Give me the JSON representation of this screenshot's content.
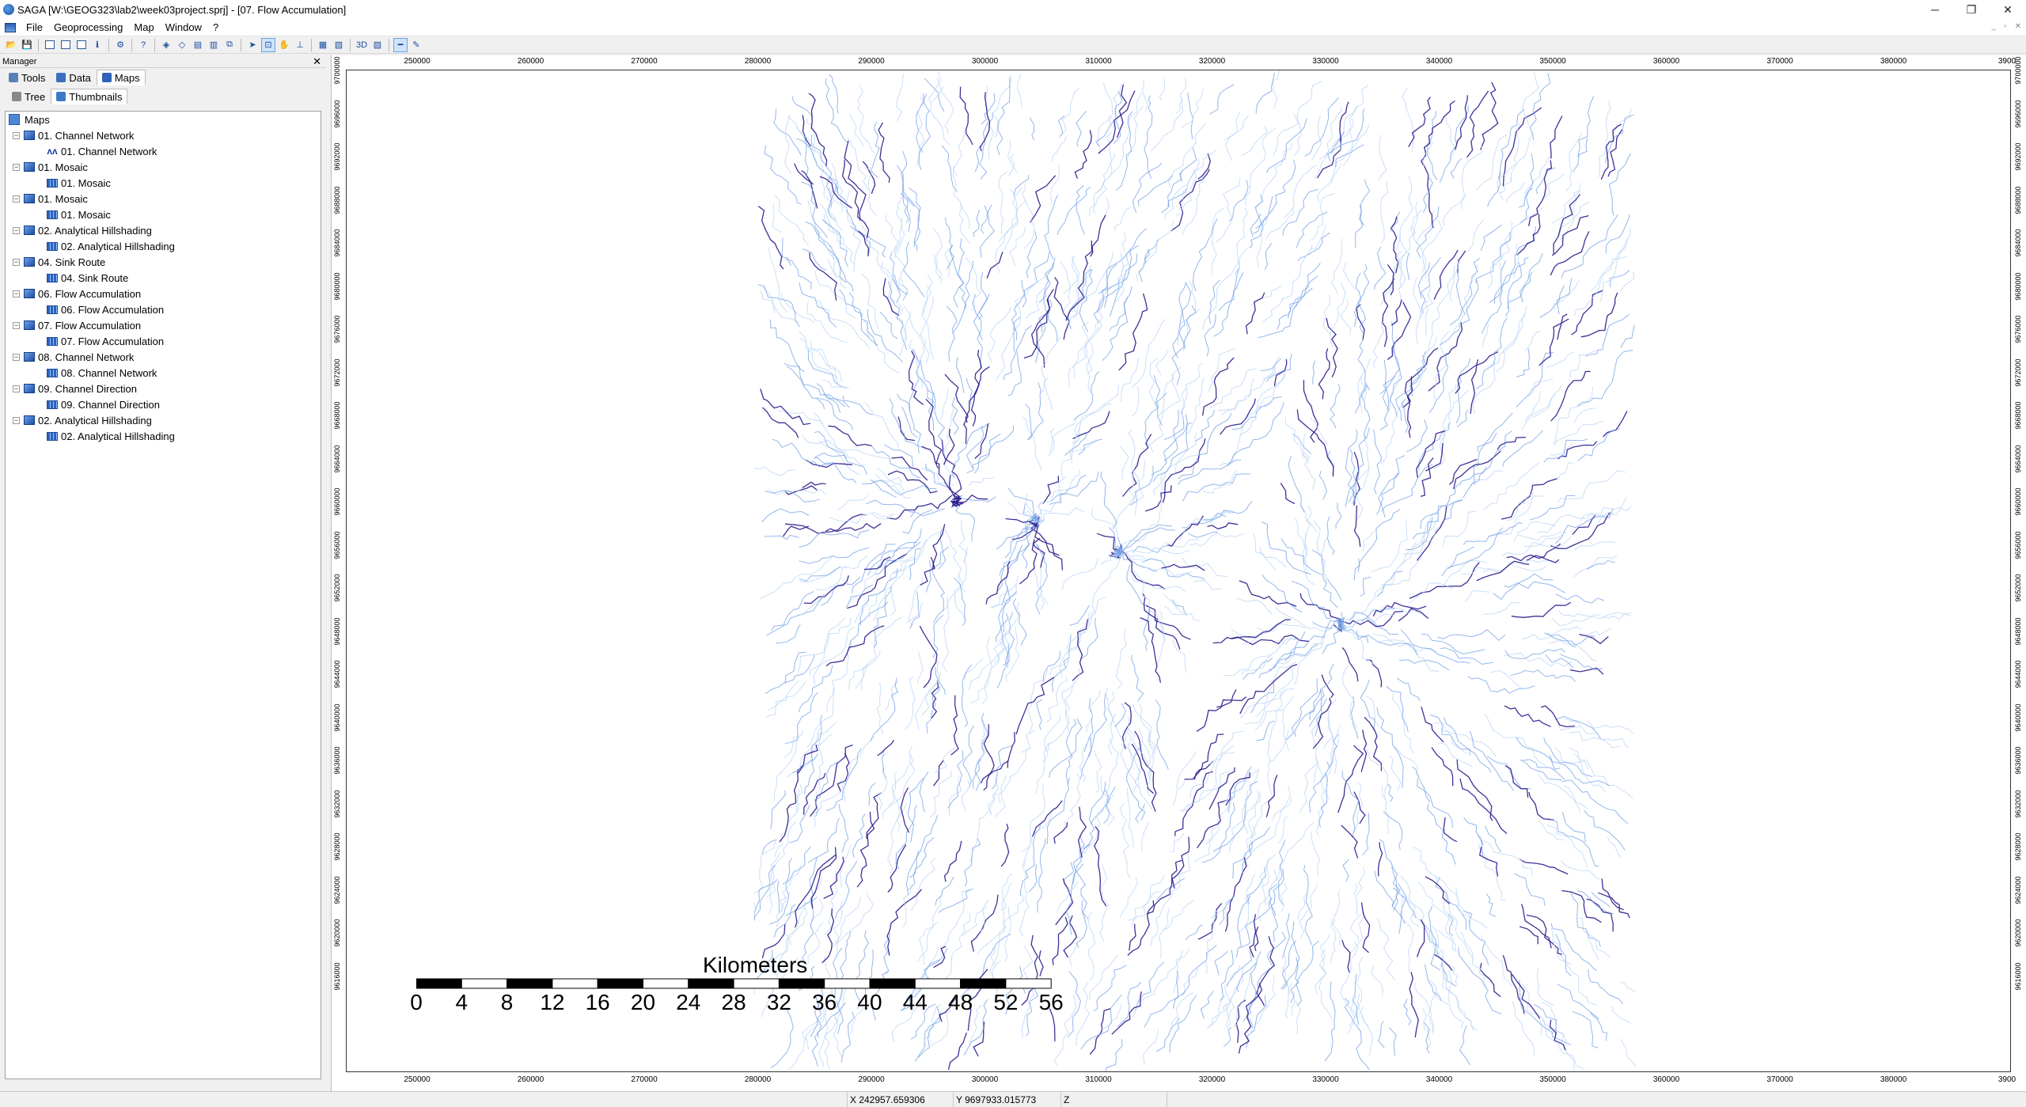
{
  "window": {
    "title": "SAGA [W:\\GEOG323\\lab2\\week03project.sprj] - [07. Flow Accumulation]",
    "controls": [
      "─",
      "❐",
      "✕"
    ]
  },
  "menu": [
    "File",
    "Geoprocessing",
    "Map",
    "Window",
    "?"
  ],
  "manager": {
    "title": "Manager",
    "close": "✕",
    "tabs": [
      {
        "label": "Tools",
        "selected": false
      },
      {
        "label": "Data",
        "selected": false
      },
      {
        "label": "Maps",
        "selected": true
      }
    ],
    "subtabs": [
      {
        "label": "Tree",
        "selected": false
      },
      {
        "label": "Thumbnails",
        "selected": true
      }
    ],
    "tree_root": "Maps",
    "maps": [
      {
        "name": "01. Channel Network",
        "layer": "01. Channel Network",
        "layer_icon": "line-icon"
      },
      {
        "name": "01. Mosaic",
        "layer": "01. Mosaic",
        "layer_icon": "grid-icon"
      },
      {
        "name": "01. Mosaic",
        "layer": "01. Mosaic",
        "layer_icon": "grid-icon"
      },
      {
        "name": "02. Analytical Hillshading",
        "layer": "02. Analytical Hillshading",
        "layer_icon": "grid-icon"
      },
      {
        "name": "04. Sink Route",
        "layer": "04. Sink Route",
        "layer_icon": "grid-icon"
      },
      {
        "name": "06. Flow Accumulation",
        "layer": "06. Flow Accumulation",
        "layer_icon": "grid-icon"
      },
      {
        "name": "07. Flow Accumulation",
        "layer": "07. Flow Accumulation",
        "layer_icon": "grid-icon"
      },
      {
        "name": "08. Channel Network",
        "layer": "08. Channel Network",
        "layer_icon": "grid-icon"
      },
      {
        "name": "09. Channel Direction",
        "layer": "09. Channel Direction",
        "layer_icon": "grid-icon"
      },
      {
        "name": "02. Analytical Hillshading",
        "layer": "02. Analytical Hillshading",
        "layer_icon": "grid-icon"
      }
    ]
  },
  "map": {
    "x_ticks": [
      "250000",
      "260000",
      "270000",
      "280000",
      "290000",
      "300000",
      "310000",
      "320000",
      "330000",
      "340000",
      "350000",
      "360000",
      "370000",
      "380000",
      "3900"
    ],
    "y_ticks": [
      "9700000",
      "9696000",
      "9692000",
      "9688000",
      "9684000",
      "9680000",
      "9676000",
      "9672000",
      "9668000",
      "9664000",
      "9660000",
      "9656000",
      "9652000",
      "9648000",
      "9644000",
      "9640000",
      "9636000",
      "9632000",
      "9628000",
      "9624000",
      "9620000",
      "9616000"
    ],
    "colors": {
      "flow_light": "#b8d4f5",
      "flow_mid": "#6f9fe6",
      "channel": "#2a1a8c"
    },
    "scalebar": {
      "title": "Kilometers",
      "labels": [
        "0",
        "4",
        "8",
        "12",
        "16",
        "20",
        "24",
        "28",
        "32",
        "36",
        "40",
        "44",
        "48",
        "52",
        "56"
      ]
    }
  },
  "status": {
    "x": "X 242957.659306",
    "y": "Y 9697933.015773",
    "z": "Z"
  }
}
